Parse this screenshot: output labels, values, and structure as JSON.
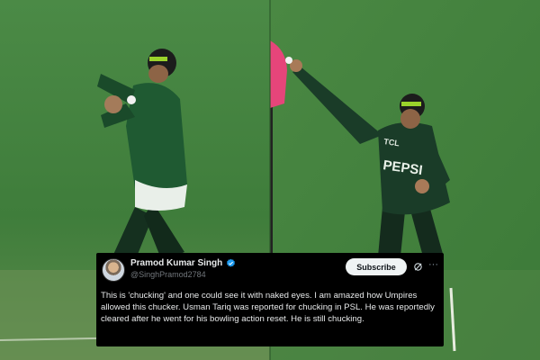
{
  "tweet": {
    "display_name": "Pramod Kumar Singh",
    "handle": "@SinghPramod2784",
    "subscribe_label": "Subscribe",
    "text": "This is 'chucking' and one could see it with naked eyes. I am amazed how Umpires allowed this chucker. Usman Tariq was reported for chucking in PSL. He was reportedly cleared after he went for  his bowling action reset. He is still chucking.",
    "icons": [
      "avatar",
      "verified-badge-icon",
      "grok-icon",
      "more-options-icon"
    ],
    "colors": {
      "card": "#000000",
      "verified": "#1d9bf0",
      "button": "#eff3f4"
    }
  },
  "background": {
    "left_jersey_text": "",
    "right_jersey_text": "PEPSI",
    "right_jersey_small_text": "TCL",
    "colors": {
      "pitch": "#3f7a3a",
      "jersey": "#1f4a2d",
      "flag": "#e6457a"
    }
  }
}
